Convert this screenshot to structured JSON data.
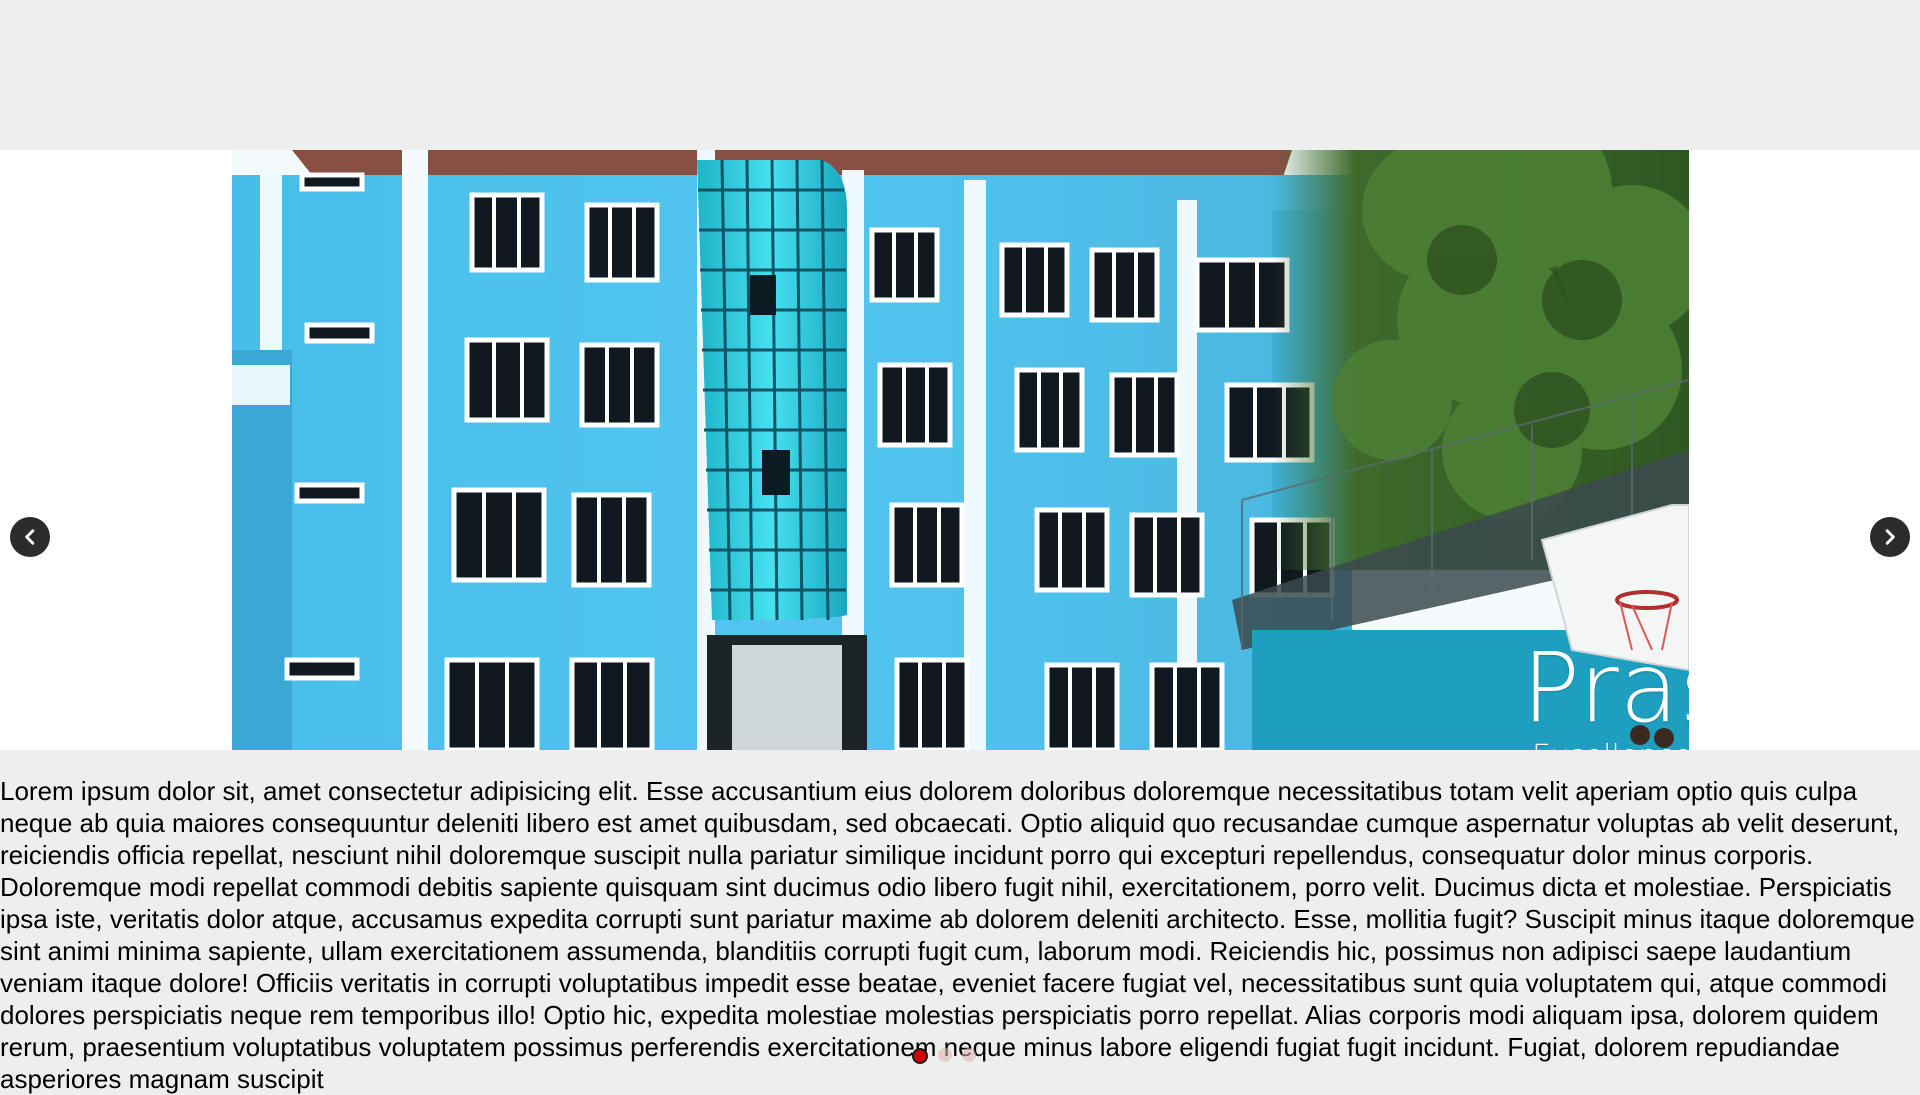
{
  "carousel": {
    "slide": {
      "brand_name": "Prasadi",
      "brand_tagline": "Excellence in Education"
    },
    "prev_icon": "chevron-left-icon",
    "next_icon": "chevron-right-icon",
    "indicators": {
      "count": 3,
      "active_index": 0,
      "active_color": "#d40000"
    }
  },
  "content": {
    "paragraph": "Lorem ipsum dolor sit, amet consectetur adipisicing elit. Esse accusantium eius dolorem doloribus doloremque necessitatibus totam velit aperiam optio quis culpa neque ab quia maiores consequuntur deleniti libero est amet quibusdam, sed obcaecati. Optio aliquid quo recusandae cumque aspernatur voluptas ab velit deserunt, reiciendis officia repellat, nesciunt nihil doloremque suscipit nulla pariatur similique incidunt porro qui excepturi repellendus, consequatur dolor minus corporis. Doloremque modi repellat commodi debitis sapiente quisquam sint ducimus odio libero fugit nihil, exercitationem, porro velit. Ducimus dicta et molestiae. Perspiciatis ipsa iste, veritatis dolor atque, accusamus expedita corrupti sunt pariatur maxime ab dolorem deleniti architecto. Esse, mollitia fugit? Suscipit minus itaque doloremque sint animi minima sapiente, ullam exercitationem assumenda, blanditiis corrupti fugit cum, laborum modi. Reiciendis hic, possimus non adipisci saepe laudantium veniam itaque dolore! Officiis veritatis in corrupti voluptatibus impedit esse beatae, eveniet facere fugiat vel, necessitatibus sunt quia voluptatem qui, atque commodi dolores perspiciatis neque rem temporibus illo! Optio hic, expedita molestiae molestias perspiciatis porro repellat. Alias corporis modi aliquam ipsa, dolorem quidem rerum, praesentium voluptatibus voluptatem possimus perferendis exercitationem neque minus labore eligendi fugiat fugit incidunt. Fugiat, dolorem repudiandae asperiores magnam suscipit"
  },
  "colors": {
    "page_bg": "#eeeeee",
    "building": "#4fc3ee",
    "nav_button": "#2b2b2b"
  }
}
